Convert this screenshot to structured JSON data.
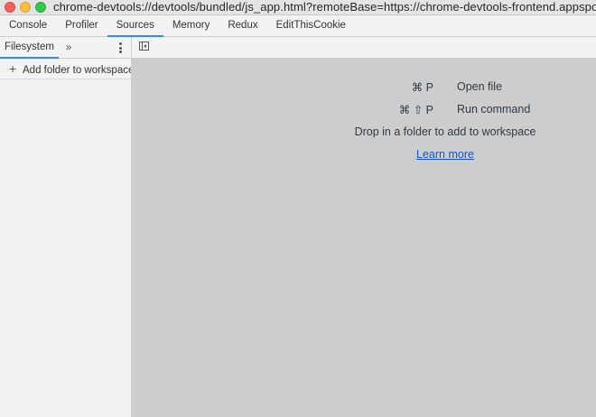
{
  "window": {
    "url": "chrome-devtools://devtools/bundled/js_app.html?remoteBase=https://chrome-devtools-frontend.appspot.com/se"
  },
  "main_tabs": [
    {
      "label": "Console"
    },
    {
      "label": "Profiler"
    },
    {
      "label": "Sources",
      "active": true
    },
    {
      "label": "Memory"
    },
    {
      "label": "Redux"
    },
    {
      "label": "EditThisCookie"
    }
  ],
  "sidebar": {
    "tab_label": "Filesystem",
    "more_tabs_glyph": "»",
    "add_folder_label": "Add folder to workspace"
  },
  "editor": {
    "shortcuts": [
      {
        "keys": "⌘ P",
        "label": "Open file"
      },
      {
        "keys": "⌘ ⇧ P",
        "label": "Run command"
      }
    ],
    "drop_text": "Drop in a folder to add to workspace",
    "learn_more": "Learn more"
  },
  "colors": {
    "accent": "#3e82f7",
    "link": "#1a55c4",
    "editor_bg": "#cdcdcd",
    "panel_bg": "#f3f3f3"
  }
}
